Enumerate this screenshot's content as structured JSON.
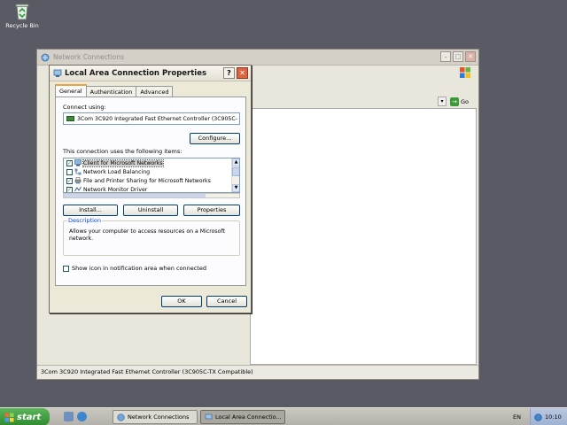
{
  "desktop": {
    "recycle_bin_label": "Recycle Bin"
  },
  "explorer": {
    "title": "Network Connections",
    "go_label": "Go",
    "status_text": "3Com 3C920 Integrated Fast Ethernet Controller (3C905C-TX Compatible)"
  },
  "dialog": {
    "title": "Local Area Connection Properties",
    "help_glyph": "?",
    "close_glyph": "✕",
    "tabs": [
      {
        "label": "General",
        "active": true
      },
      {
        "label": "Authentication",
        "active": false
      },
      {
        "label": "Advanced",
        "active": false
      }
    ],
    "connect_using_label": "Connect using:",
    "adapter_name": "3Com 3C920 Integrated Fast Ethernet Controller (3C905C-",
    "configure_label": "Configure...",
    "items_label": "This connection uses the following items:",
    "items": [
      {
        "label": "Client for Microsoft Networks",
        "checked": true,
        "selected": true,
        "icon": "client-icon"
      },
      {
        "label": "Network Load Balancing",
        "checked": false,
        "selected": false,
        "icon": "network-icon"
      },
      {
        "label": "File and Printer Sharing for Microsoft Networks",
        "checked": true,
        "selected": false,
        "icon": "printer-icon"
      },
      {
        "label": "Network Monitor Driver",
        "checked": true,
        "selected": false,
        "icon": "monitor-driver-icon"
      }
    ],
    "install_label": "Install...",
    "uninstall_label": "Uninstall",
    "properties_label": "Properties",
    "description_legend": "Description",
    "description_text": "Allows your computer to access resources on a Microsoft network.",
    "show_icon_label": "Show icon in notification area when connected",
    "show_icon_checked": false,
    "ok_label": "OK",
    "cancel_label": "Cancel"
  },
  "taskbar": {
    "start_label": "start",
    "tasks": [
      {
        "label": "Network Connections",
        "active": false
      },
      {
        "label": "Local Area Connectio...",
        "active": true
      }
    ],
    "language": "EN",
    "clock": "10:10"
  }
}
